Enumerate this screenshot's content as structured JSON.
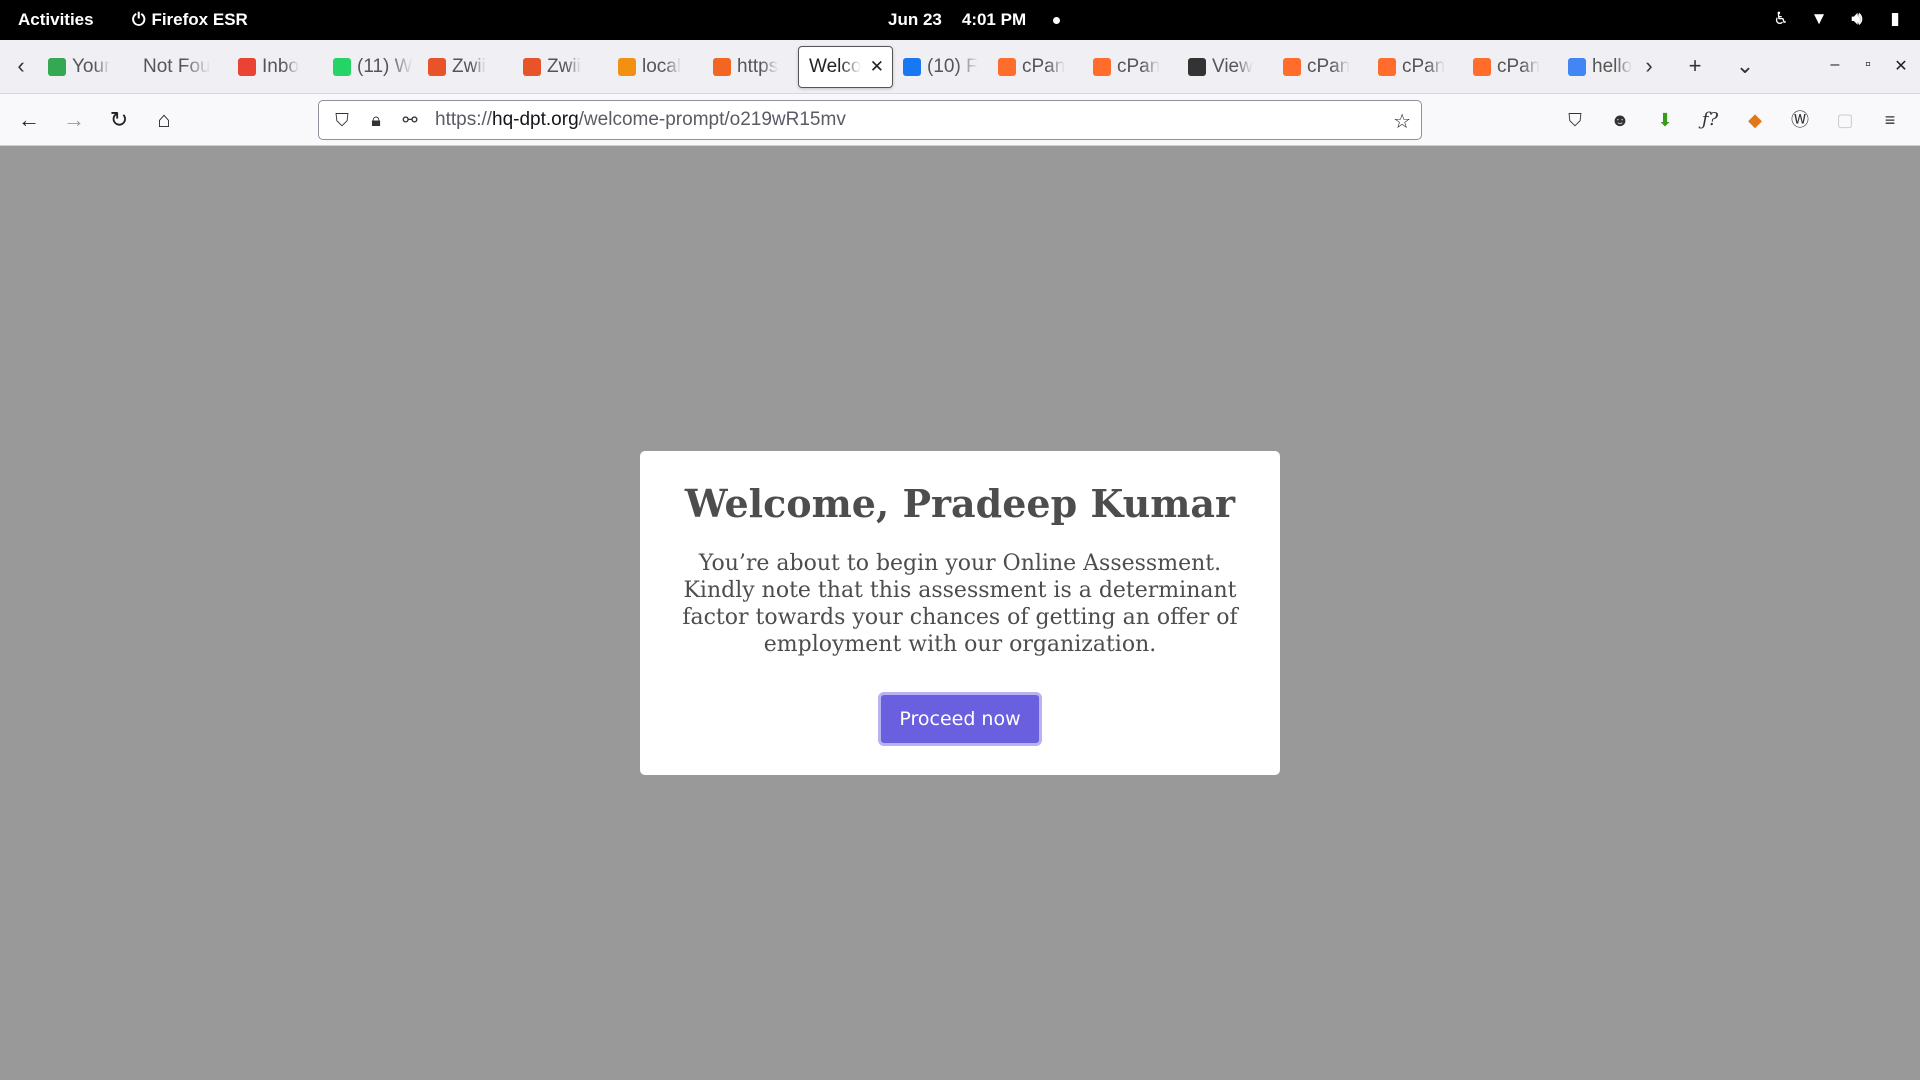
{
  "topbar": {
    "activities": "Activities",
    "app_name": "Firefox ESR",
    "date": "Jun 23",
    "time": "4:01 PM"
  },
  "tabs": [
    {
      "label": "Your",
      "favicon": "google-icon",
      "color": "#34a853"
    },
    {
      "label": "Not Fou",
      "favicon": "",
      "color": ""
    },
    {
      "label": "Inbo",
      "favicon": "gmail-icon",
      "color": "#ea4335"
    },
    {
      "label": "(11) W",
      "favicon": "whatsapp-icon",
      "color": "#25d366"
    },
    {
      "label": "Zwii",
      "favicon": "zwii-icon",
      "color": "#e8542a"
    },
    {
      "label": "Zwii",
      "favicon": "zwii-icon",
      "color": "#e8542a"
    },
    {
      "label": "local",
      "favicon": "phpmyadmin-icon",
      "color": "#f29111"
    },
    {
      "label": "https",
      "favicon": "ringcentral-icon",
      "color": "#f26522"
    },
    {
      "label": "Welco",
      "favicon": "",
      "color": "",
      "active": true
    },
    {
      "label": "(10) F",
      "favicon": "facebook-icon",
      "color": "#1877f2"
    },
    {
      "label": "cPan",
      "favicon": "cpanel-icon",
      "color": "#ff6c2c"
    },
    {
      "label": "cPan",
      "favicon": "cpanel-icon",
      "color": "#ff6c2c"
    },
    {
      "label": "View",
      "favicon": "helm-icon",
      "color": "#333333"
    },
    {
      "label": "cPan",
      "favicon": "cpanel-icon",
      "color": "#ff6c2c"
    },
    {
      "label": "cPan",
      "favicon": "cpanel-icon",
      "color": "#ff6c2c"
    },
    {
      "label": "cPan",
      "favicon": "cpanel-icon",
      "color": "#ff6c2c"
    },
    {
      "label": "hello",
      "favicon": "google-icon",
      "color": "#4285f4"
    }
  ],
  "urlbar": {
    "scheme": "https://",
    "host": "hq-dpt.org",
    "path": "/welcome-prompt/o219wR15mv"
  },
  "modal": {
    "title": "Welcome, Pradeep Kumar",
    "message": "You’re about to begin your Online Assessment. Kindly note that this assessment is a determinant factor towards your chances of getting an offer of employment with our organization.",
    "button": "Proceed now"
  },
  "colors": {
    "page_background": "#999999",
    "button": "#6a5fde",
    "text": "#4d4d4d"
  }
}
